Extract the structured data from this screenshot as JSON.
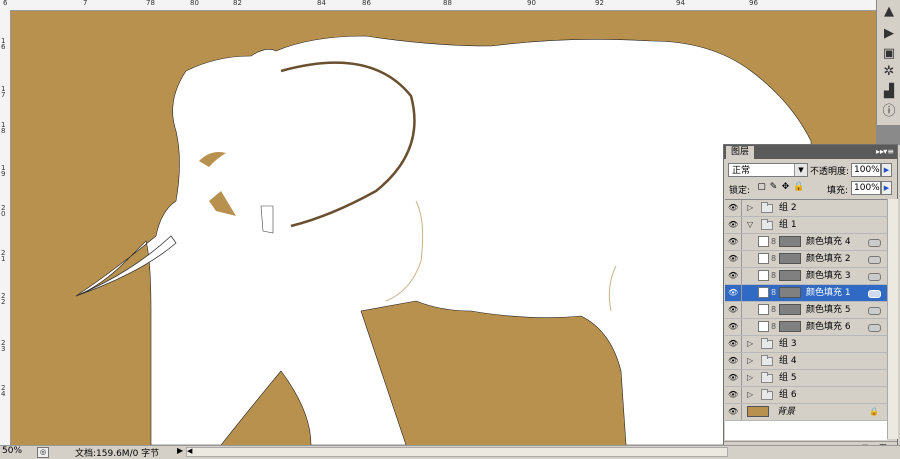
{
  "ruler_top": [
    "6",
    "7",
    "78",
    "80",
    "82",
    "84",
    "86",
    "88",
    "90",
    "92",
    "94",
    "96"
  ],
  "ruler_left": [
    "1 6",
    "1 7",
    "1 8",
    "1 9",
    "2 0",
    "2 1",
    "2 2",
    "2 3",
    "2 4"
  ],
  "tool_strip": [
    {
      "icon": "scroll-up-icon",
      "glyph": "▲"
    },
    {
      "icon": "play-icon",
      "glyph": "▶"
    },
    {
      "icon": "layers-icon",
      "glyph": "▣"
    },
    {
      "icon": "navigator-icon",
      "glyph": "✲"
    },
    {
      "icon": "histogram-icon",
      "glyph": "▟"
    },
    {
      "icon": "info-icon",
      "glyph": "ⓘ"
    }
  ],
  "status": {
    "zoom": "50%",
    "doc_info": "文档:159.6M/0 字节"
  },
  "layers_panel": {
    "tab_label": "图层",
    "close_glyph": "▸▸",
    "menu_glyph": "▾≡",
    "blend_mode": "正常",
    "opacity_label": "不透明度:",
    "opacity_value": "100%",
    "lock_label": "锁定:",
    "fill_label": "填充:",
    "fill_value": "100%",
    "layers": [
      {
        "name": "组 2",
        "type": "group",
        "expanded": false,
        "indent": 0
      },
      {
        "name": "组 1",
        "type": "group",
        "expanded": true,
        "indent": 0
      },
      {
        "name": "颜色填充 4",
        "type": "fill",
        "indent": 1
      },
      {
        "name": "颜色填充 2",
        "type": "fill",
        "indent": 1
      },
      {
        "name": "颜色填充 3",
        "type": "fill",
        "indent": 1
      },
      {
        "name": "颜色填充 1",
        "type": "fill",
        "indent": 1,
        "selected": true
      },
      {
        "name": "颜色填充 5",
        "type": "fill",
        "indent": 1
      },
      {
        "name": "颜色填充 6",
        "type": "fill",
        "indent": 1
      },
      {
        "name": "组 3",
        "type": "group",
        "expanded": false,
        "indent": 0
      },
      {
        "name": "组 4",
        "type": "group",
        "expanded": false,
        "indent": 0
      },
      {
        "name": "组 5",
        "type": "group",
        "expanded": false,
        "indent": 0
      },
      {
        "name": "组 6",
        "type": "group",
        "expanded": false,
        "indent": 0
      },
      {
        "name": "背景",
        "type": "background",
        "indent": 0
      }
    ],
    "footer_icons": [
      "link-icon",
      "fx-icon",
      "mask-icon",
      "adjustment-icon",
      "new-group-icon",
      "new-layer-icon",
      "trash-icon"
    ]
  },
  "colors": {
    "canvas_bg": "#b8914e",
    "selection": "#316ac5",
    "elephant": "#ffffff"
  }
}
